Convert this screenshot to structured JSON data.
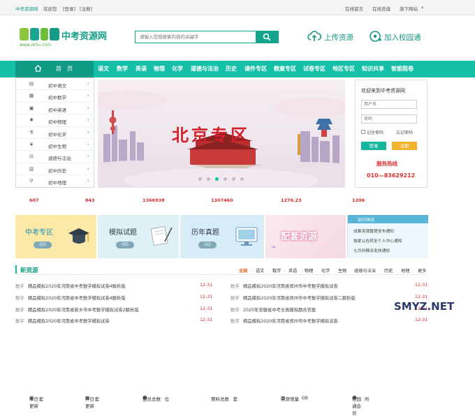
{
  "topbar": {
    "site": "中考资源网",
    "welcome": "欢迎您",
    "login": "[登录]",
    "register": "[注册]",
    "links": [
      "在线留言",
      "在线充值",
      "旗下网站"
    ]
  },
  "logo": {
    "title": "中考资源网",
    "url": "www.zk5u.com"
  },
  "search": {
    "placeholder": "请输入您想搜索内容的关键字"
  },
  "actions": {
    "upload": "上传资源",
    "join": "加入校园通"
  },
  "nav": {
    "home": "首　页",
    "items": [
      "语文",
      "数学",
      "英语",
      "物理",
      "化学",
      "道德与法治",
      "历史",
      "课件专区",
      "教案专区",
      "试卷专区",
      "地区专区",
      "知识共享",
      "智能阻卷"
    ]
  },
  "sidebar": {
    "items": [
      "初中语文",
      "初中数学",
      "初中英语",
      "初中物理",
      "初中化学",
      "初中生物",
      "道德与法治",
      "初中历史",
      "初中地理"
    ]
  },
  "banner": {
    "text": "北京专区"
  },
  "login": {
    "title": "欢迎来到中考资源网",
    "username": "用户名",
    "password": "密码",
    "remember": "记住密码",
    "forgot": "忘记密码",
    "login_btn": "登录",
    "register_btn": "注册",
    "hotline_label": "服务热线",
    "hotline": "010—83629212"
  },
  "stats": [
    {
      "label": "本日更新",
      "value": "607",
      "unit": "套"
    },
    {
      "label": "昨日更新",
      "value": "843",
      "unit": "套"
    },
    {
      "label": "会员总数",
      "value": "1366938",
      "unit": "位"
    },
    {
      "label": "资料总数",
      "value": "1307460",
      "unit": "套"
    },
    {
      "label": "资源增量",
      "value": "1276.23",
      "unit": "GB"
    },
    {
      "label": "校园通会员",
      "value": "1206",
      "unit": "所"
    }
  ],
  "cards": [
    {
      "title": "中考专区",
      "go": "GO"
    },
    {
      "title": "模拟试题",
      "go": "GO"
    },
    {
      "title": "历年真题",
      "go": "GO"
    },
    {
      "title": "配套资源",
      "go": ""
    }
  ],
  "news": {
    "title": "站内快讯",
    "items": [
      "成套资源整理发布通知",
      "独家公告转至个人中心通知",
      "七月份精派发放通知"
    ]
  },
  "section": {
    "title": "新资源",
    "tabs": [
      "全部",
      "语文",
      "数学",
      "英语",
      "物理",
      "化学",
      "生物",
      "道德与法治",
      "历史",
      "地理",
      "更多"
    ]
  },
  "resources_left": [
    {
      "cat": "数学",
      "title": "精品模拟2020年河南省中考数学模拟试卷4解析版",
      "date": "12-31"
    },
    {
      "cat": "数学",
      "title": "精品模拟2020年河南省中考数学模拟试卷4解析版",
      "date": "12-31"
    },
    {
      "cat": "数学",
      "title": "精品模拟2020年河南省新乡市中考数学模拟试卷2解析版",
      "date": "12-31"
    },
    {
      "cat": "数学",
      "title": "精品模拟2020年河南省中考数学模拟试卷",
      "date": "12-31"
    }
  ],
  "resources_right": [
    {
      "cat": "数学",
      "title": "精品模拟2020年河南省郑州市中考数学模拟试卷",
      "date": "12-31"
    },
    {
      "cat": "数学",
      "title": "精品模拟2020年河南省郑州市中考数学模拟试卷二解析版",
      "date": "12-31"
    },
    {
      "cat": "数学",
      "title": "2020年安徽省中考全真模拟题含答案",
      "date": "12-31"
    },
    {
      "cat": "数学",
      "title": "精品模拟2020年河南省郑州市中考数学模拟试卷",
      "date": "12-31"
    }
  ],
  "watermark": "SMYZ.NET"
}
